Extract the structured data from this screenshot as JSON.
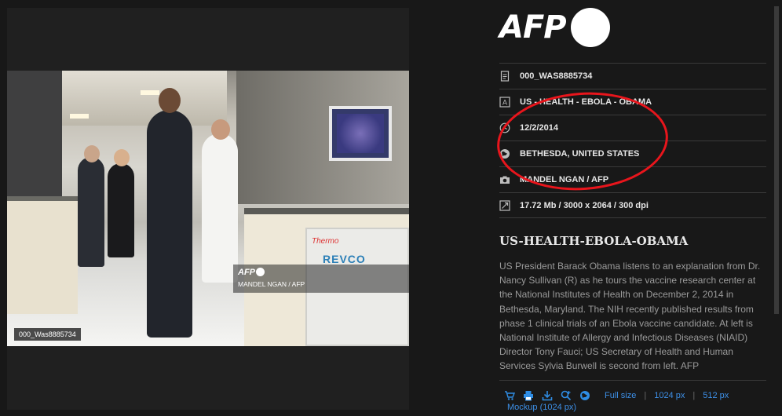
{
  "brand": {
    "logo_text": "AFP"
  },
  "photo": {
    "watermark_logo": "AFP",
    "watermark_credit": "MANDEL NGAN / AFP",
    "id_tag": "000_Was8885734",
    "machine_label": "REVCO",
    "machine_brand": "Thermo"
  },
  "metadata": [
    {
      "icon": "document-icon",
      "value": "000_WAS8885734"
    },
    {
      "icon": "text-icon",
      "value": "US - HEALTH - EBOLA - OBAMA"
    },
    {
      "icon": "clock-icon",
      "value": "12/2/2014"
    },
    {
      "icon": "globe-icon",
      "value": "BETHESDA, UNITED STATES"
    },
    {
      "icon": "camera-icon",
      "value": "MANDEL NGAN / AFP"
    },
    {
      "icon": "resize-icon",
      "value": "17.72 Mb / 3000 x 2064 / 300 dpi"
    }
  ],
  "article": {
    "title": "US-HEALTH-EBOLA-OBAMA",
    "description": "US President Barack Obama listens to an explanation from Dr. Nancy Sullivan (R) as he tours the vaccine research center at the National Institutes of Health on December 2, 2014 in Bethesda, Maryland. The NIH recently published results from phase 1 clinical trials of an Ebola vaccine candidate. At left is National Institute of Allergy and Infectious Diseases (NIAID) Director Tony Fauci; US Secretary of Health and Human Services Sylvia Burwell is second from left. AFP"
  },
  "actions": {
    "icons": [
      "cart-icon",
      "print-icon",
      "download-icon",
      "zoom-in-icon",
      "globe-icon"
    ],
    "full_size": "Full size",
    "size_1024": "1024 px",
    "size_512": "512 px",
    "separator": "|",
    "mockup": "Mockup (1024 px)"
  },
  "colors": {
    "accent": "#3d8fe6",
    "annotation": "#e8151c",
    "background": "#181818"
  }
}
